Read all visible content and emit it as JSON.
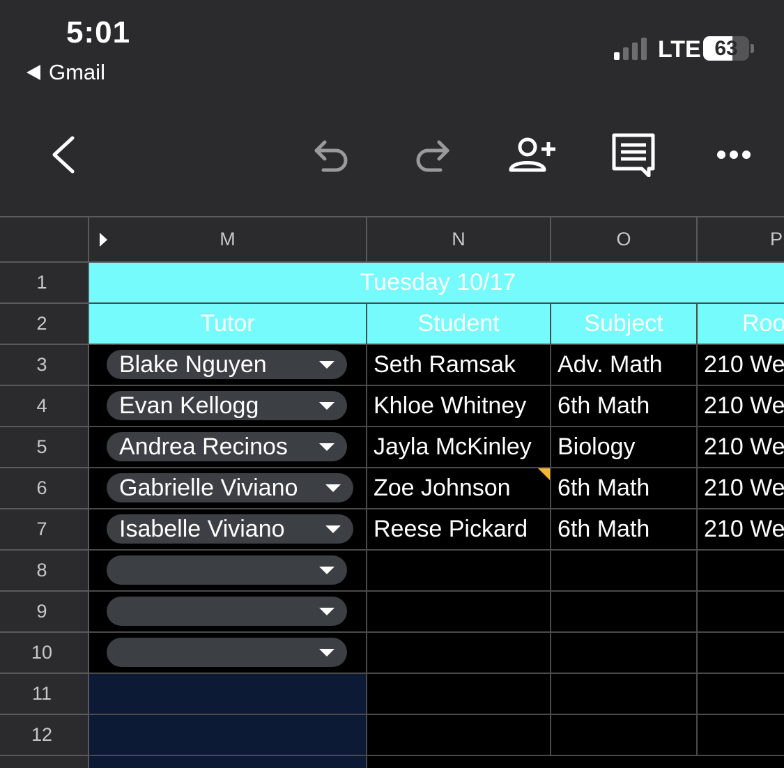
{
  "status_bar": {
    "time": "5:01",
    "back_app": "Gmail",
    "network": "LTE",
    "battery": "63",
    "signal_bars_active": 1,
    "signal_bars_total": 4
  },
  "toolbar": {
    "icons": [
      "back-chevron-icon",
      "undo-icon",
      "redo-icon",
      "add-person-icon",
      "comment-icon",
      "more-icon"
    ]
  },
  "sheet": {
    "columns": [
      "M",
      "N",
      "O",
      "P"
    ],
    "rows": [
      "1",
      "2",
      "3",
      "4",
      "5",
      "6",
      "7",
      "8",
      "9",
      "10",
      "11",
      "12"
    ],
    "title_row": "Tuesday 10/17",
    "headers": {
      "tutor": "Tutor",
      "student": "Student",
      "subject": "Subject",
      "room": "Roo"
    },
    "data_rows": [
      {
        "tutor": "Blake Nguyen",
        "student": "Seth Ramsak",
        "subject": "Adv. Math",
        "room": "210 We"
      },
      {
        "tutor": "Evan Kellogg",
        "student": "Khloe Whitney",
        "subject": "6th Math",
        "room": "210 We"
      },
      {
        "tutor": "Andrea Recinos",
        "student": "Jayla McKinley",
        "subject": "Biology",
        "room": "210 We"
      },
      {
        "tutor": "Gabrielle Viviano",
        "student": "Zoe Johnson",
        "subject": "6th Math",
        "room": "210 We"
      },
      {
        "tutor": "Isabelle Viviano",
        "student": "Reese Pickard",
        "subject": "6th Math",
        "room": "210 We"
      },
      {
        "tutor": "",
        "student": "",
        "subject": "",
        "room": ""
      },
      {
        "tutor": "",
        "student": "",
        "subject": "",
        "room": ""
      },
      {
        "tutor": "",
        "student": "",
        "subject": "",
        "room": ""
      }
    ],
    "colors": {
      "header_fill": "#76fbfd",
      "selected_fill": "#0d1a36",
      "note_marker": "#f5b632"
    }
  }
}
